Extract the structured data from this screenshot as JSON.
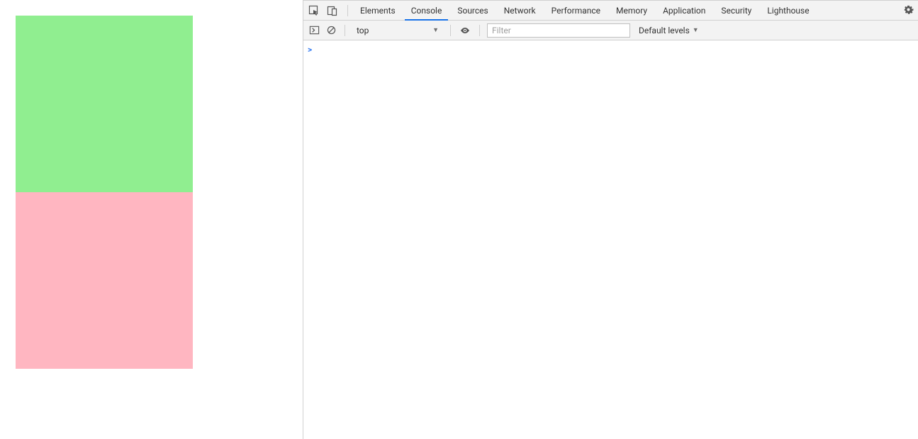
{
  "page": {
    "colors": {
      "green": "#90ee90",
      "pink": "#ffb6c1"
    }
  },
  "devtools": {
    "tabs": [
      "Elements",
      "Console",
      "Sources",
      "Network",
      "Performance",
      "Memory",
      "Application",
      "Security",
      "Lighthouse"
    ],
    "active_tab_index": 1,
    "toolbar": {
      "context": "top",
      "filter_placeholder": "Filter",
      "filter_value": "",
      "levels_label": "Default levels"
    },
    "console": {
      "prompt": ">"
    }
  }
}
